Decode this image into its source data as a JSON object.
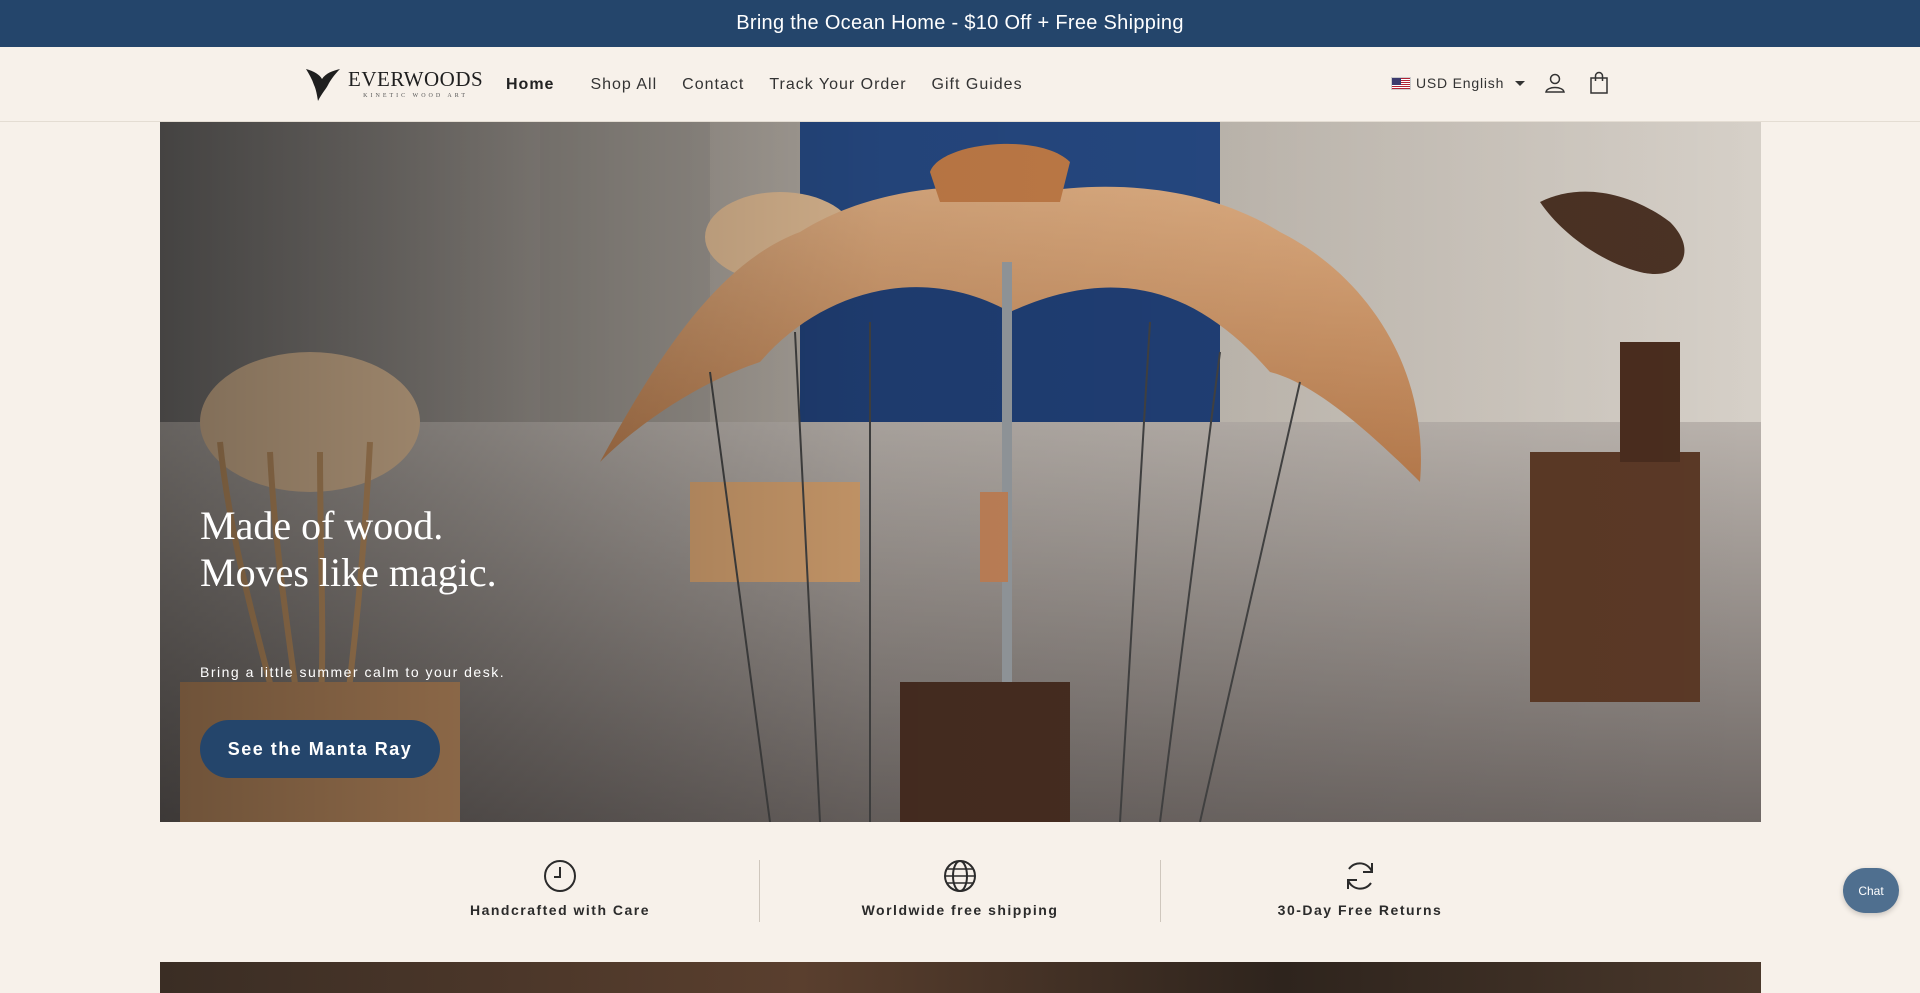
{
  "announcement": {
    "text": "Bring the Ocean Home - $10 Off + Free Shipping"
  },
  "header": {
    "logo": {
      "name": "EVERWOODS",
      "tagline": "KINETIC WOOD ART",
      "icon": "manta-ray-icon"
    },
    "nav": [
      {
        "label": "Home",
        "active": true
      },
      {
        "label": "Shop All"
      },
      {
        "label": "Contact"
      },
      {
        "label": "Track Your Order"
      },
      {
        "label": "Gift Guides"
      }
    ],
    "locale": {
      "label": "USD English",
      "flag": "us-flag-icon"
    },
    "account_icon": "user-icon",
    "cart_icon": "shopping-bag-icon"
  },
  "hero": {
    "title_line1": "Made of wood.",
    "title_line2": "Moves like magic.",
    "subtitle": "Bring a little summer calm to your desk.",
    "cta": "See the Manta Ray"
  },
  "features": [
    {
      "icon": "clock-icon",
      "label": "Handcrafted with Care"
    },
    {
      "icon": "globe-icon",
      "label": "Worldwide free shipping"
    },
    {
      "icon": "refresh-icon",
      "label": "30-Day Free Returns"
    }
  ],
  "chat": {
    "label": "Chat"
  },
  "colors": {
    "brand": "#24456b",
    "background": "#f7f1ea",
    "chat": "#4f6f8f"
  }
}
